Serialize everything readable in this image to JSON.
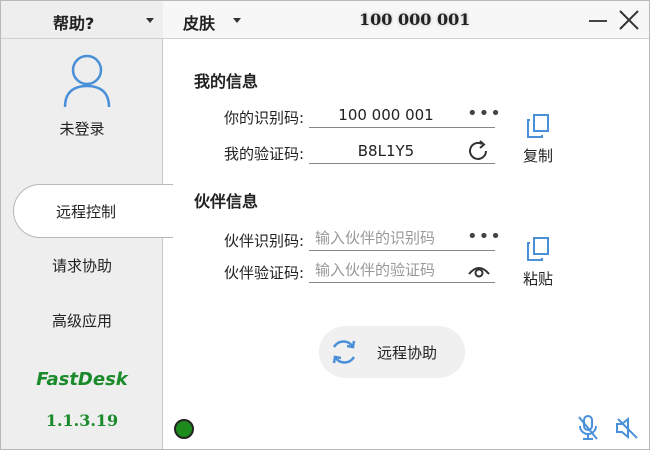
{
  "sidebar": {
    "help_label": "帮助?",
    "login_label": "未登录",
    "nav": [
      {
        "label": "远程控制",
        "active": true
      },
      {
        "label": "请求协助",
        "active": false
      },
      {
        "label": "高级应用",
        "active": false
      }
    ],
    "brand": "FastDesk",
    "version": "1.1.3.19"
  },
  "topbar": {
    "skin_label": "皮肤",
    "title": "100 000 001"
  },
  "my_info": {
    "title": "我的信息",
    "id_label": "你的识别码:",
    "id_value": "100 000 001",
    "code_label": "我的验证码:",
    "code_value": "B8L1Y5",
    "copy_label": "复制"
  },
  "partner_info": {
    "title": "伙伴信息",
    "id_label": "伙伴识别码:",
    "id_placeholder": "输入伙伴的识别码",
    "code_label": "伙伴验证码:",
    "code_placeholder": "输入伙伴的验证码",
    "paste_label": "粘贴"
  },
  "assist_button_label": "远程协助",
  "colors": {
    "accent_blue": "#4a90d9",
    "brand_green": "#1a8a2a",
    "status_green": "#1c8a1c"
  },
  "icons": {
    "avatar": "user-avatar-icon",
    "refresh": "refresh-icon",
    "eye": "eye-icon",
    "copy": "copy-icon",
    "paste": "paste-icon",
    "sync": "sync-icon",
    "mic": "microphone-muted-icon",
    "speaker": "speaker-muted-icon"
  }
}
